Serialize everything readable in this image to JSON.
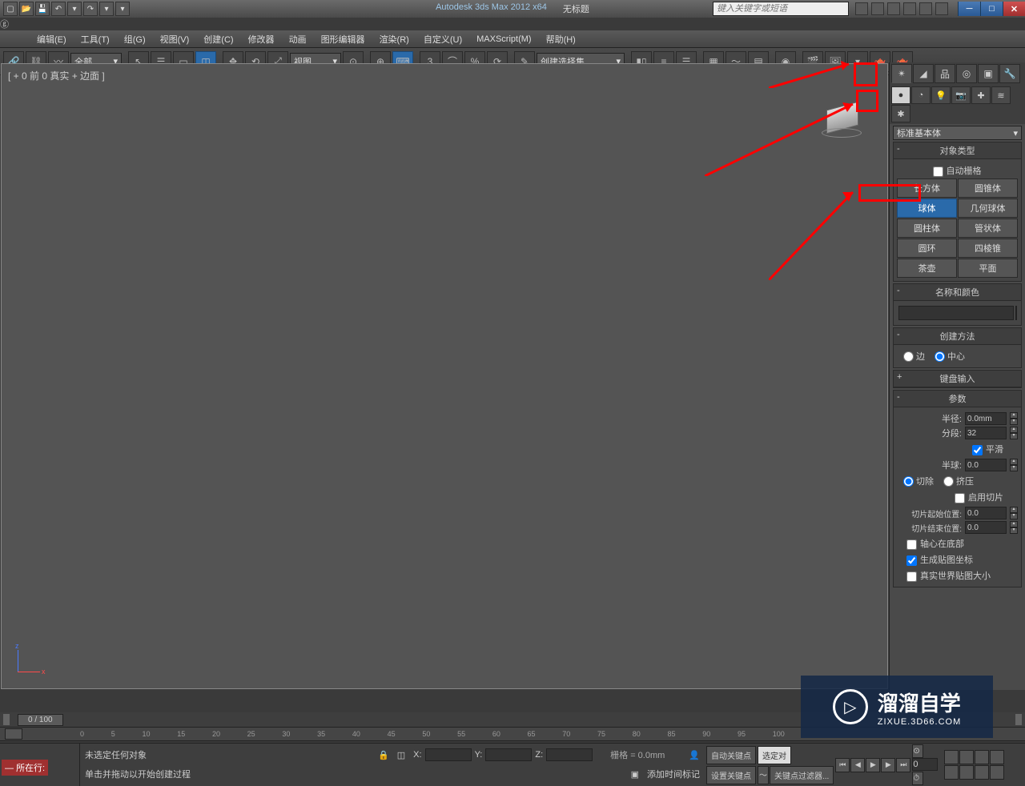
{
  "title": {
    "app": "Autodesk 3ds Max 2012 x64",
    "doc": "无标题"
  },
  "search_placeholder": "键入关键字或短语",
  "menu": [
    "编辑(E)",
    "工具(T)",
    "组(G)",
    "视图(V)",
    "创建(C)",
    "修改器",
    "动画",
    "图形编辑器",
    "渲染(R)",
    "自定义(U)",
    "MAXScript(M)",
    "帮助(H)"
  ],
  "toolbar": {
    "filter_dd": "全部",
    "view_dd": "视图",
    "selset_dd": "创建选择集"
  },
  "viewport": {
    "label": "[ + 0 前 0 真实 + 边面 ]",
    "axis": {
      "z": "z",
      "x": "x"
    }
  },
  "panel": {
    "category_dd": "标准基本体",
    "rollouts": {
      "obj_type": {
        "title": "对象类型",
        "autogrid": "自动栅格",
        "buttons": [
          "长方体",
          "圆锥体",
          "球体",
          "几何球体",
          "圆柱体",
          "管状体",
          "圆环",
          "四棱锥",
          "茶壶",
          "平面"
        ],
        "selected": "球体"
      },
      "name_color": {
        "title": "名称和颜色"
      },
      "create_method": {
        "title": "创建方法",
        "opt_edge": "边",
        "opt_center": "中心"
      },
      "kb_input": {
        "title": "键盘输入"
      },
      "params": {
        "title": "参数",
        "radius_lbl": "半径:",
        "radius_val": "0.0mm",
        "segs_lbl": "分段:",
        "segs_val": "32",
        "smooth": "平滑",
        "hemi_lbl": "半球:",
        "hemi_val": "0.0",
        "chop": "切除",
        "squash": "挤压",
        "slice_on": "启用切片",
        "slice_from_lbl": "切片起始位置:",
        "slice_from_val": "0.0",
        "slice_to_lbl": "切片结束位置:",
        "slice_to_val": "0.0",
        "base_pivot": "轴心在底部",
        "gen_uv": "生成贴图坐标",
        "real_world": "真实世界贴图大小"
      }
    }
  },
  "timeline": {
    "slider": "0 / 100",
    "ticks": [
      "0",
      "5",
      "10",
      "15",
      "20",
      "25",
      "30",
      "35",
      "40",
      "45",
      "50",
      "55",
      "60",
      "65",
      "70",
      "75",
      "80",
      "85",
      "90",
      "95",
      "100"
    ]
  },
  "status": {
    "prompt1": "未选定任何对象",
    "prompt2": "单击并拖动以开始创建过程",
    "grid": "栅格 = 0.0mm",
    "x": "X:",
    "y": "Y:",
    "z": "Z:",
    "autokey": "自动关键点",
    "setkey": "设置关键点",
    "selected_dd": "选定对",
    "keyfilter": "关键点过滤器...",
    "addtime": "添加时间标记",
    "mscript": "所在行:",
    "frame": "0"
  },
  "watermark": {
    "line1": "溜溜自学",
    "line2": "ZIXUE.3D66.COM"
  },
  "winbtns": {
    "min": "─",
    "max": "□",
    "close": "✕"
  }
}
